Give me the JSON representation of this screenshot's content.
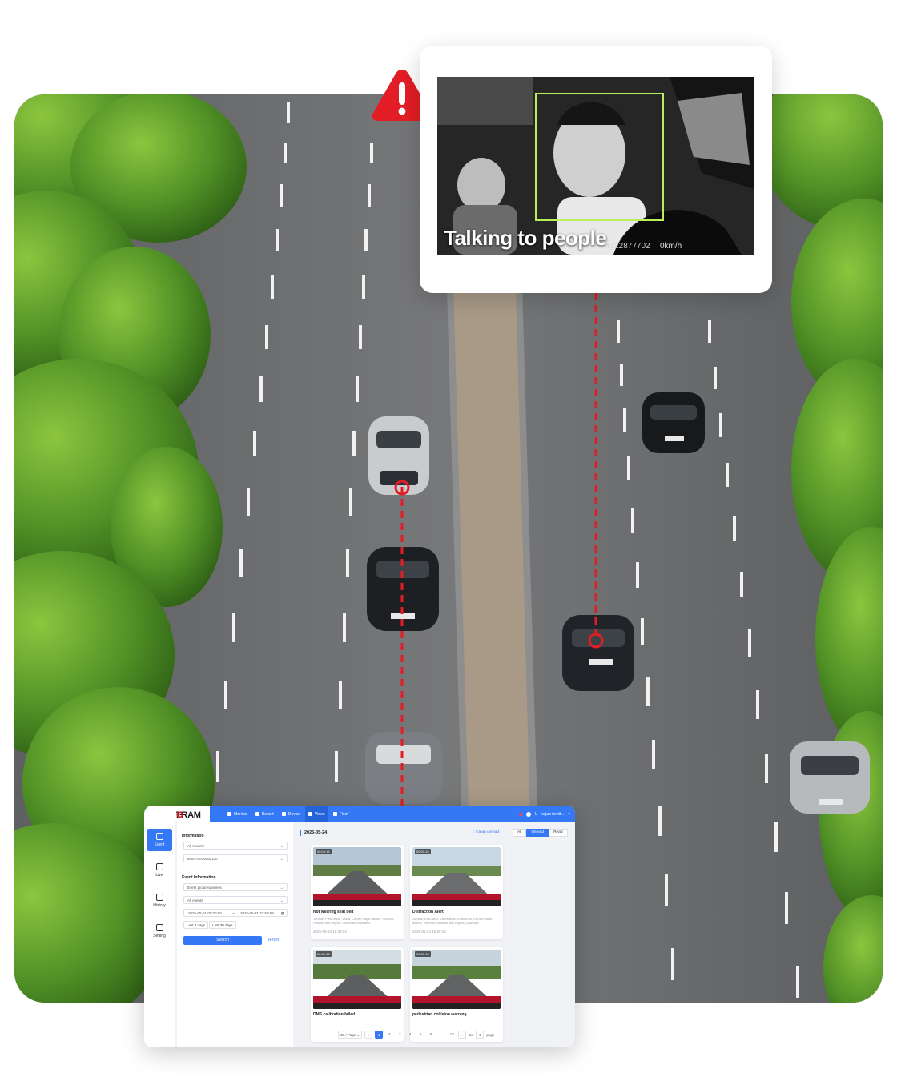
{
  "alert": {
    "caption": "Talking to people",
    "device_id": "4722877702",
    "speed": "0km/h",
    "icon": "warning-triangle-icon",
    "accent": "#e31d25",
    "box_color": "#b9ef5a"
  },
  "app": {
    "brand_before": "TRAM",
    "brand_i": "I",
    "brand_after": "G",
    "brand_o": "O",
    "nav": [
      {
        "label": "Monitor",
        "icon": "location-pin-icon"
      },
      {
        "label": "Report",
        "icon": "bar-chart-icon"
      },
      {
        "label": "Device",
        "icon": "users-icon"
      },
      {
        "label": "Video",
        "icon": "video-camera-icon",
        "active": true
      },
      {
        "label": "Fleet",
        "icon": "truck-icon"
      }
    ],
    "user_short": "U",
    "user_name": "wijaa rientt...",
    "rail": [
      {
        "label": "Event",
        "icon": "event-icon",
        "active": true
      },
      {
        "label": "Live",
        "icon": "live-icon"
      },
      {
        "label": "History",
        "icon": "history-icon"
      },
      {
        "label": "Setting",
        "icon": "setting-icon"
      }
    ],
    "filters": {
      "information_label": "Information",
      "model_value": "All models",
      "device_value": "865470070000130",
      "event_info_label": "Event Information",
      "media_value": "Event pictures/videos",
      "event_type_value": "All events",
      "date_start": "2025-05-01 00:00:00",
      "date_sep": "~",
      "date_end": "2025-05-31 23:59:59",
      "quick_7": "Last 7 days",
      "quick_30": "Last 30 days",
      "search_label": "Search",
      "reset_label": "Reset"
    },
    "content": {
      "date": "2025-05-24",
      "clean_label": "Clean unread",
      "seg_all": "All",
      "seg_unread": "Unread",
      "seg_read": "Read",
      "cards": [
        {
          "duration": "00:00:15",
          "title": "Not wearing seat belt",
          "location": "Jonatie, Pies Valdo, Valda, Centre major district, Helsinki, Helsinki sub-region, Uusimaa, Mainland...",
          "time": "2025-05-24 15:38:04",
          "cams": "2  2"
        },
        {
          "duration": "00:00:15",
          "title": "Distraction Alert",
          "location": "Jonatie, Eco-Atrid, Kaliosaena, Sornainen, Centre major district, Helsinki, Helsinki sub-region, Uusimaa...",
          "time": "2025-05-24 15:29:15",
          "cams": "2  2"
        },
        {
          "duration": "00:00:15",
          "title": "DMS calibration failed",
          "location": "",
          "time": "",
          "cams": "2  2"
        },
        {
          "duration": "00:00:15",
          "title": "pedestrian collision warning",
          "location": "",
          "time": "",
          "cams": "2  2"
        }
      ]
    },
    "pagination": {
      "page_size": "30 / Page",
      "pages": [
        "1",
        "2",
        "3",
        "4",
        "5",
        "6",
        "...",
        "13"
      ],
      "current": "1",
      "goto_label": "Go",
      "goto_value": "1",
      "page_suffix": "page"
    },
    "brand_color": "#3478f6"
  }
}
